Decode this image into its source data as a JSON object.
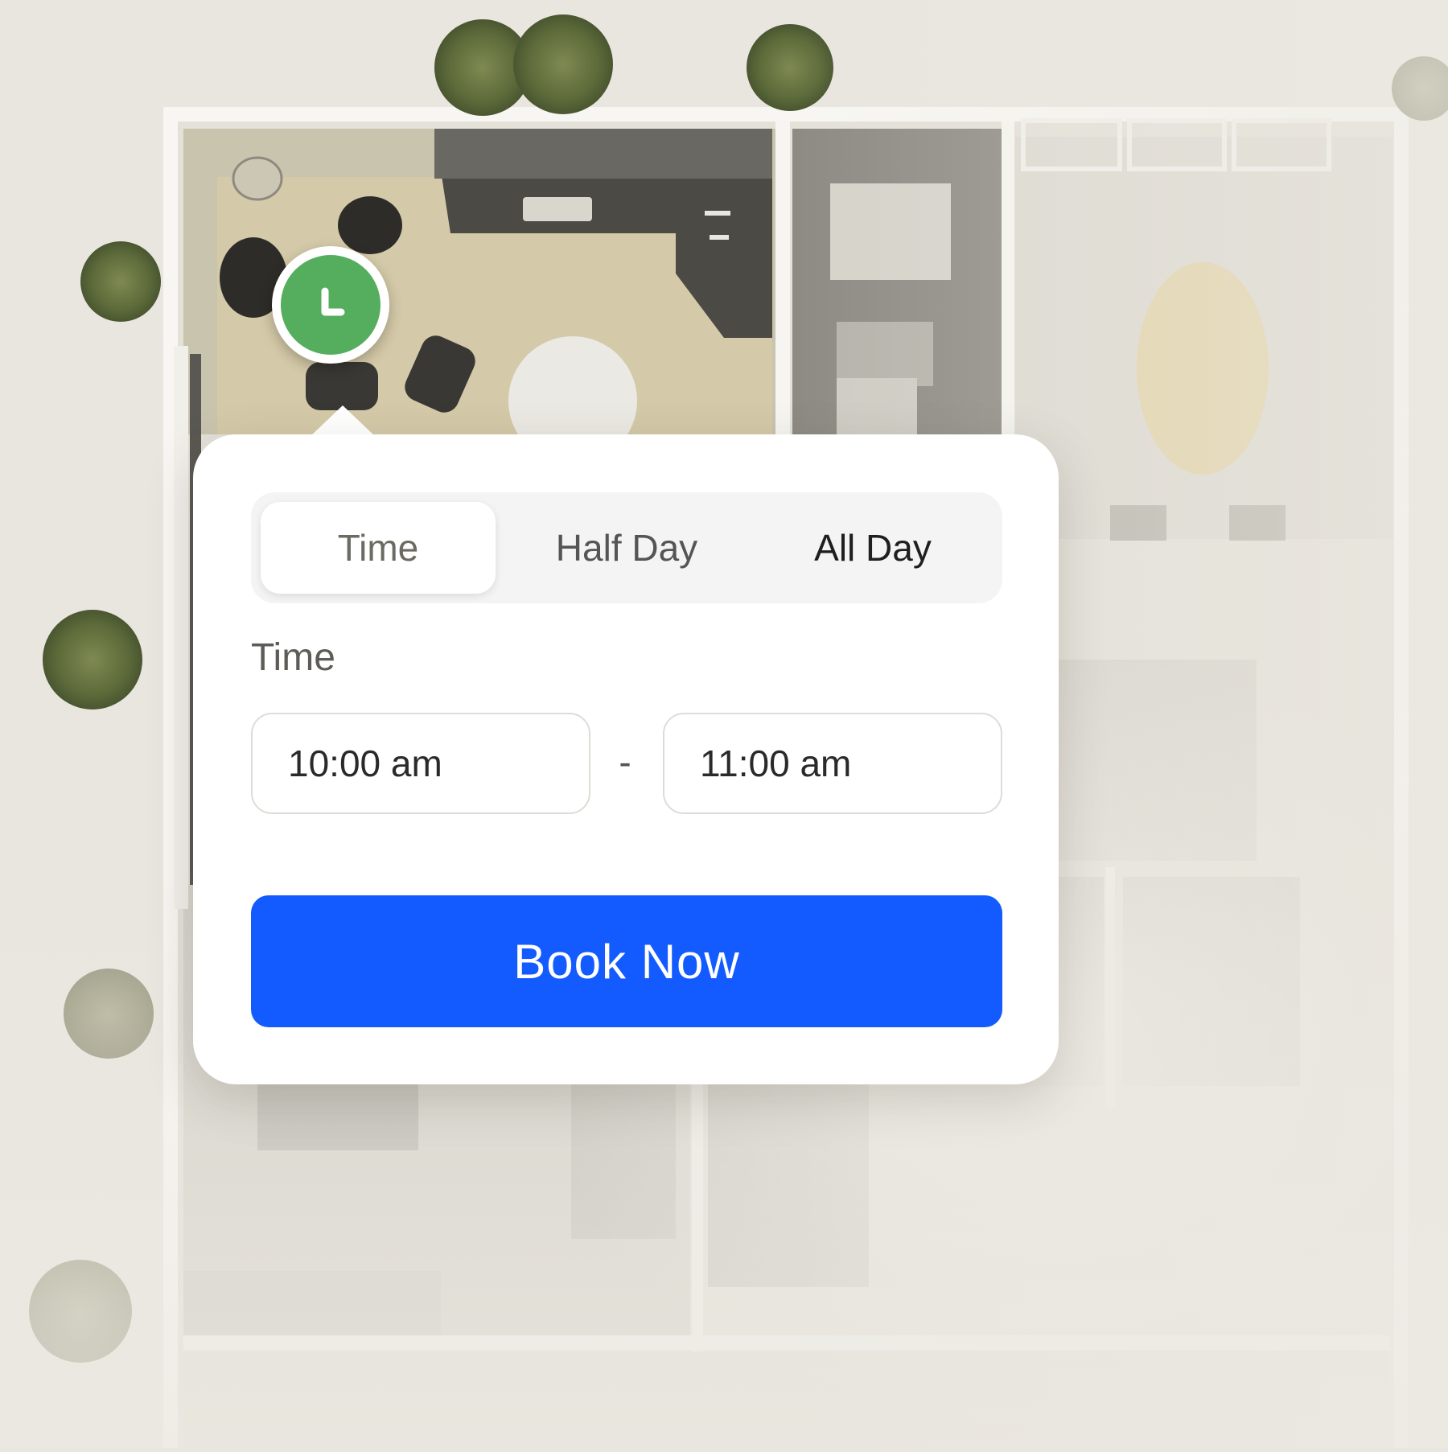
{
  "map": {
    "pin_icon": "clock-icon",
    "pin_color": "#55ad5e"
  },
  "booking": {
    "modes": [
      {
        "label": "Time",
        "selected": true
      },
      {
        "label": "Half Day",
        "selected": false
      },
      {
        "label": "All Day",
        "selected": false
      }
    ],
    "section_label": "Time",
    "start_time": "10:00 am",
    "separator": "-",
    "end_time": "11:00 am",
    "book_button_label": "Book Now",
    "book_button_color": "#135bff"
  }
}
